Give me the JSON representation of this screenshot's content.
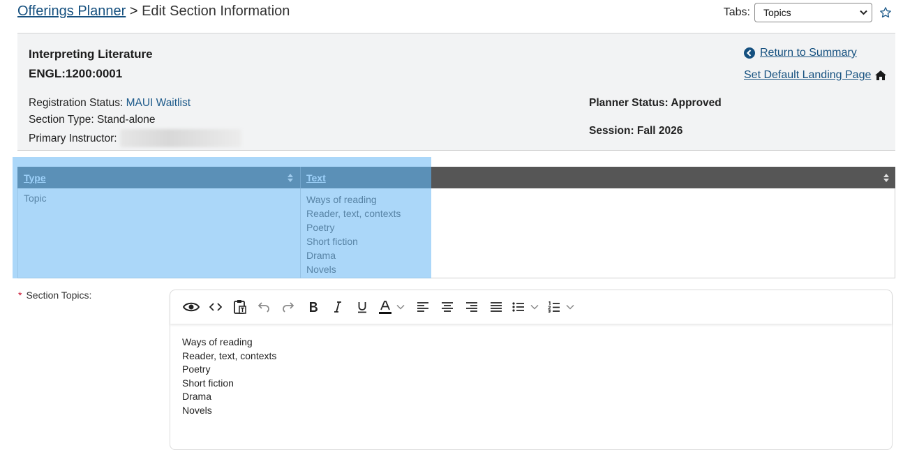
{
  "breadcrumb": {
    "root": "Offerings Planner",
    "separator": ">",
    "current": "Edit Section Information"
  },
  "tabs": {
    "label": "Tabs:",
    "selected": "Topics"
  },
  "course": {
    "title": "Interpreting Literature",
    "code": "ENGL:1200:0001"
  },
  "info": {
    "registration_label": "Registration Status:",
    "registration_value": "MAUI Waitlist",
    "section_type": "Section Type: Stand-alone",
    "instructor_label": "Primary Instructor:",
    "planner_status": "Planner Status: Approved",
    "session": "Session: Fall 2026"
  },
  "links": {
    "return_summary": "Return to Summary",
    "default_landing": "Set Default Landing Page"
  },
  "table": {
    "headers": [
      "Type",
      "Text"
    ],
    "rows": [
      {
        "type": "Topic",
        "text": [
          "Ways of reading",
          "Reader, text, contexts",
          "Poetry",
          "Short fiction",
          "Drama",
          "Novels"
        ]
      }
    ]
  },
  "editor": {
    "label": "Section Topics:",
    "required_mark": "*",
    "content": [
      "Ways of reading",
      "Reader, text, contexts",
      "Poetry",
      "Short fiction",
      "Drama",
      "Novels"
    ]
  },
  "colors": {
    "link": "#15507f",
    "header_dark": "#2e4452",
    "header_gray": "#565656",
    "highlight": "#a4d4f8",
    "required": "#c8102e"
  }
}
